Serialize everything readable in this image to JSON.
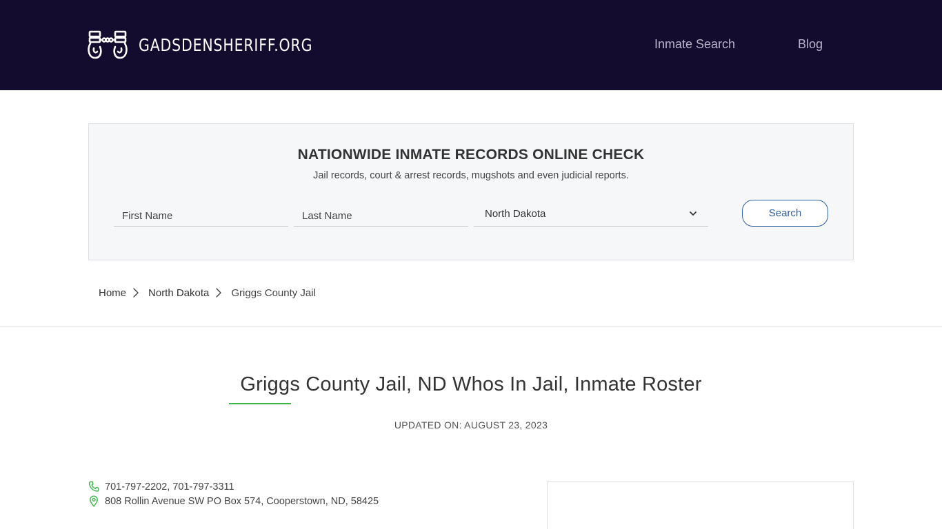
{
  "header": {
    "logo_text": "GADSDENSHERIFF.ORG",
    "logo_icon": "handcuffs-icon",
    "nav": [
      {
        "label": "Inmate Search"
      },
      {
        "label": "Blog"
      }
    ]
  },
  "search_panel": {
    "title": "NATIONWIDE INMATE RECORDS ONLINE CHECK",
    "subtitle": "Jail records, court & arrest records, mugshots and even judicial reports.",
    "first_name_placeholder": "First Name",
    "last_name_placeholder": "Last Name",
    "state_selected": "North Dakota",
    "search_label": "Search"
  },
  "breadcrumb": {
    "items": [
      {
        "label": "Home"
      },
      {
        "label": "North Dakota"
      },
      {
        "label": "Griggs County Jail"
      }
    ]
  },
  "main": {
    "title": "Griggs County Jail, ND Whos In Jail, Inmate Roster",
    "updated": "UPDATED ON: AUGUST 23, 2023",
    "phone": "701-797-2202, 701-797-3311",
    "address": "808 Rollin Avenue SW PO Box 574, Cooperstown, ND, 58425"
  },
  "colors": {
    "header_bg": "#140c2e",
    "accent_green": "#3bb54a",
    "button_blue": "#2c5f9e"
  }
}
